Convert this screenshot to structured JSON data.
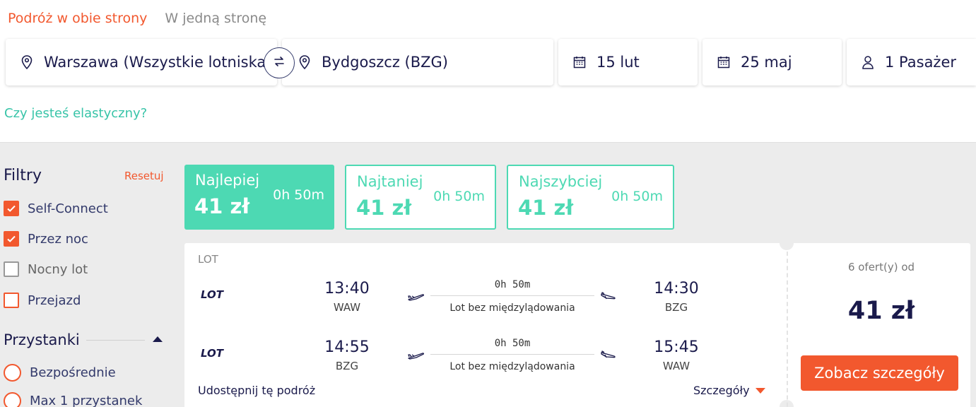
{
  "trip_type": {
    "round_trip": "Podróż w obie strony",
    "one_way": "W jedną stronę"
  },
  "search": {
    "origin": "Warszawa (Wszystkie lotniska)",
    "destination": "Bydgoszcz (BZG)",
    "depart_date": "15 lut",
    "return_date": "25 maj",
    "passengers": "1 Pasażer"
  },
  "flexible_link": "Czy jesteś elastyczny?",
  "filters": {
    "title": "Filtry",
    "reset": "Resetuj",
    "options": [
      {
        "label": "Self-Connect",
        "checked": true
      },
      {
        "label": "Przez noc",
        "checked": true
      },
      {
        "label": "Nocny lot",
        "checked": false
      },
      {
        "label": "Przejazd",
        "checked": false
      }
    ],
    "stops_title": "Przystanki",
    "stops": [
      "Bezpośrednie",
      "Max 1 przystanek"
    ]
  },
  "sort_tabs": [
    {
      "label": "Najlepiej",
      "price": "41 zł",
      "duration": "0h 50m",
      "active": true
    },
    {
      "label": "Najtaniej",
      "price": "41 zł",
      "duration": "0h 50m",
      "active": false
    },
    {
      "label": "Najszybciej",
      "price": "41 zł",
      "duration": "0h 50m",
      "active": false
    }
  ],
  "result": {
    "airline": "LOT",
    "logo_text": "LOT",
    "legs": [
      {
        "dep_time": "13:40",
        "dep_code": "WAW",
        "duration": "0h 50m",
        "stops": "Lot bez międzylądowania",
        "arr_time": "14:30",
        "arr_code": "BZG"
      },
      {
        "dep_time": "14:55",
        "dep_code": "BZG",
        "duration": "0h 50m",
        "stops": "Lot bez międzylądowania",
        "arr_time": "15:45",
        "arr_code": "WAW"
      }
    ],
    "share": "Udostępnij tę podróż",
    "details": "Szczegóły",
    "offers": "6 ofert(y) od",
    "price": "41 zł",
    "cta": "Zobacz szczegóły"
  },
  "colors": {
    "accent": "#f2582e",
    "teal": "#4dd9b3",
    "navy": "#1a1a4b"
  }
}
